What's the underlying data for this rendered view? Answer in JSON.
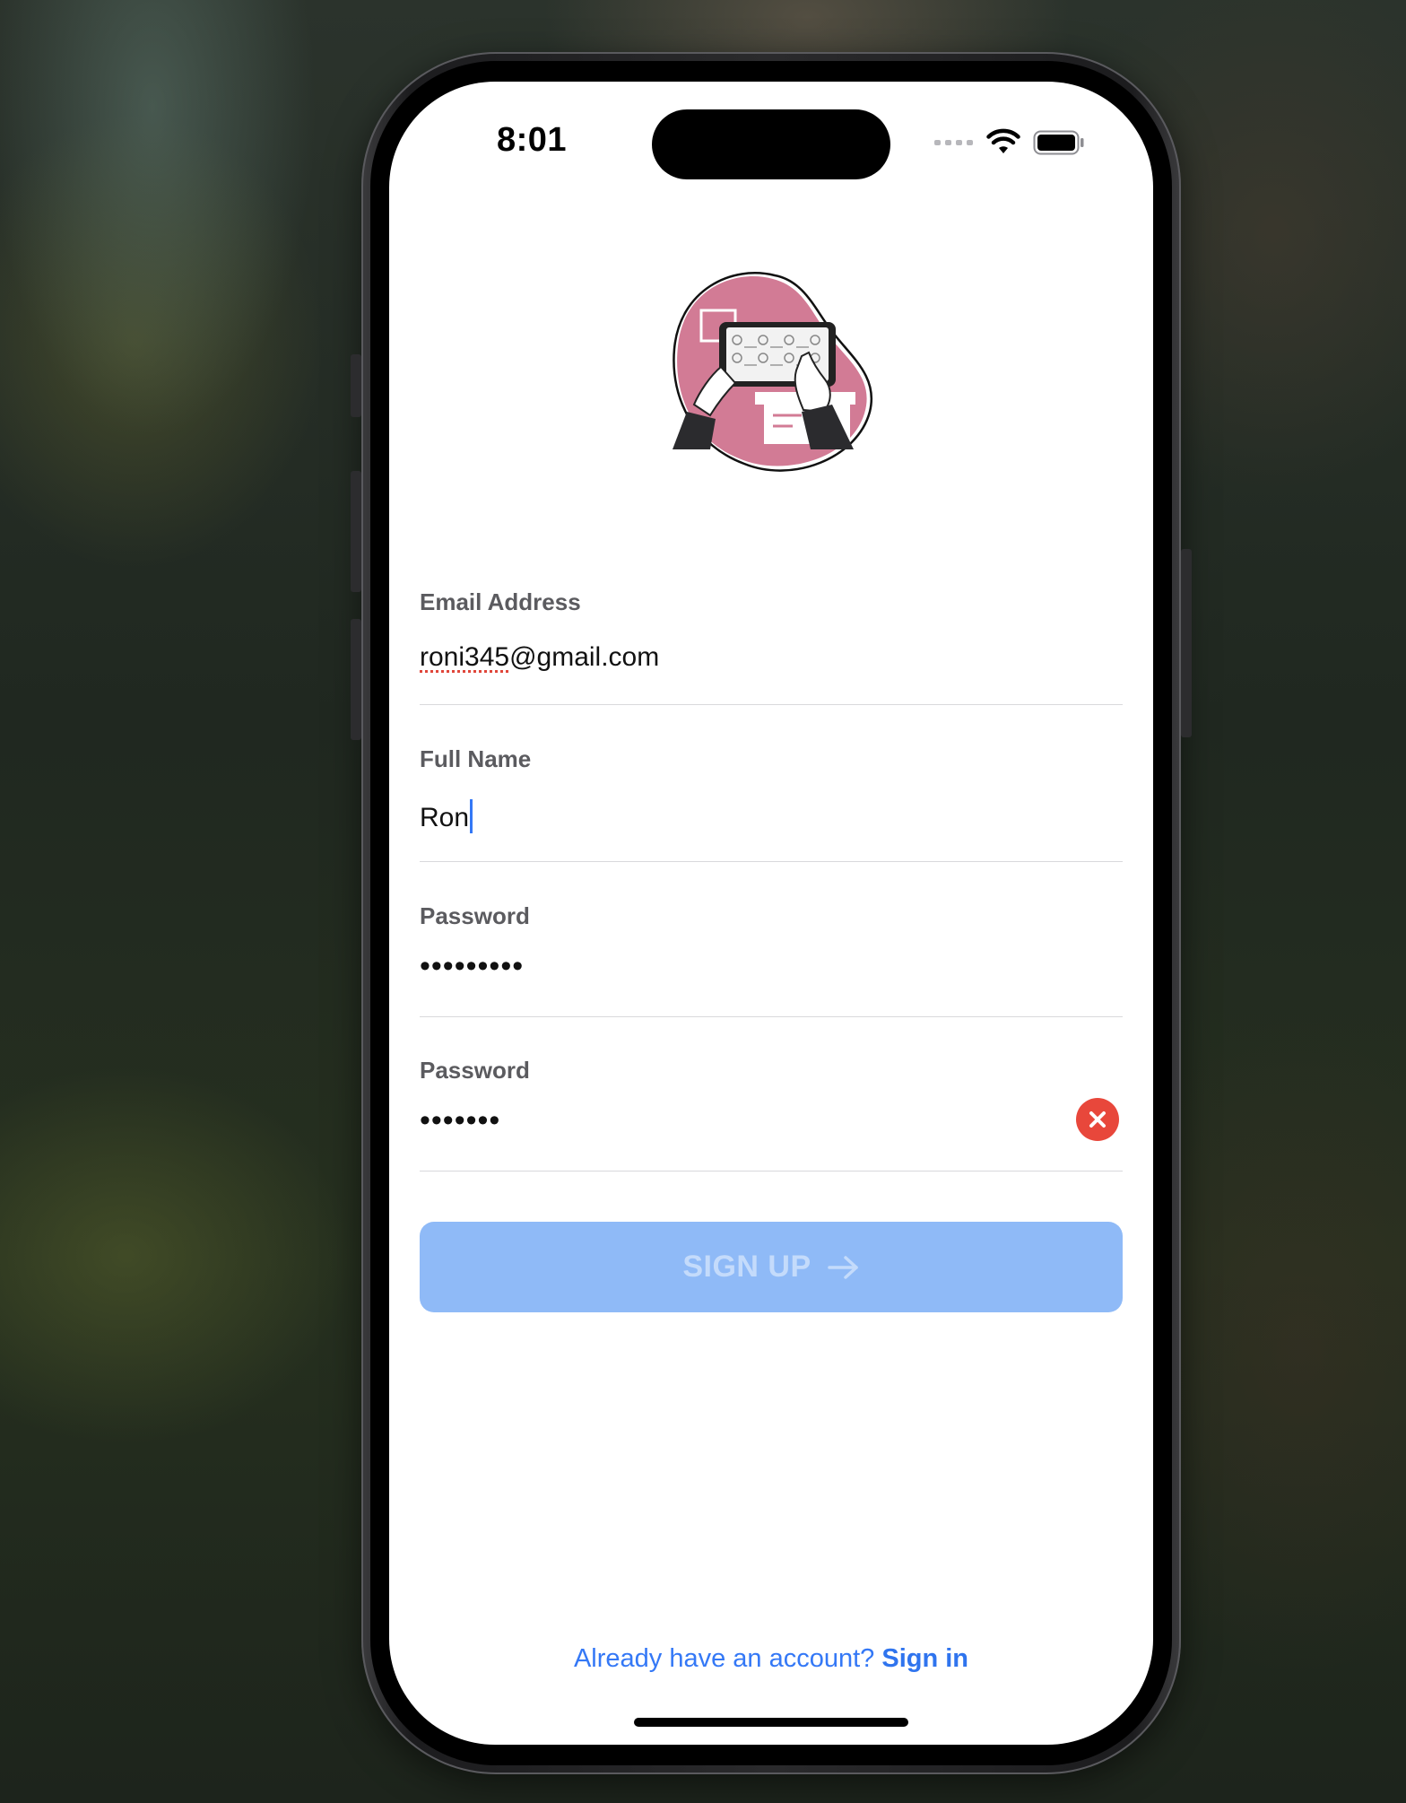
{
  "status_bar": {
    "time": "8:01"
  },
  "illustration": {
    "icon": "hands-holding-tablet-illustration",
    "accent_color": "#d27b95"
  },
  "form": {
    "email": {
      "label": "Email Address",
      "value_misspelled": "roni345",
      "value_rest": "@gmail.com"
    },
    "full_name": {
      "label": "Full Name",
      "value": "Ron"
    },
    "password": {
      "label": "Password",
      "value": "•••••••••"
    },
    "confirm_password": {
      "label": "Password",
      "value": "•••••••",
      "clear_icon": "x-circle-icon"
    }
  },
  "signup_button": {
    "label": "SIGN UP",
    "icon": "arrow-right-icon",
    "color": "#8fbaf7",
    "enabled": false
  },
  "footer": {
    "prompt": "Already have an account?",
    "link": "Sign in"
  }
}
